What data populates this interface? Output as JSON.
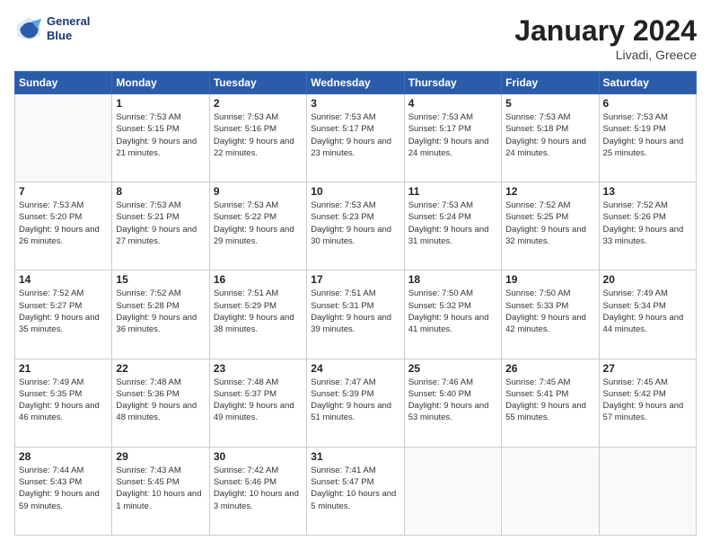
{
  "logo": {
    "line1": "General",
    "line2": "Blue"
  },
  "header": {
    "month": "January 2024",
    "location": "Livadi, Greece"
  },
  "weekdays": [
    "Sunday",
    "Monday",
    "Tuesday",
    "Wednesday",
    "Thursday",
    "Friday",
    "Saturday"
  ],
  "weeks": [
    [
      {
        "day": "",
        "sunrise": "",
        "sunset": "",
        "daylight": ""
      },
      {
        "day": "1",
        "sunrise": "Sunrise: 7:53 AM",
        "sunset": "Sunset: 5:15 PM",
        "daylight": "Daylight: 9 hours and 21 minutes."
      },
      {
        "day": "2",
        "sunrise": "Sunrise: 7:53 AM",
        "sunset": "Sunset: 5:16 PM",
        "daylight": "Daylight: 9 hours and 22 minutes."
      },
      {
        "day": "3",
        "sunrise": "Sunrise: 7:53 AM",
        "sunset": "Sunset: 5:17 PM",
        "daylight": "Daylight: 9 hours and 23 minutes."
      },
      {
        "day": "4",
        "sunrise": "Sunrise: 7:53 AM",
        "sunset": "Sunset: 5:17 PM",
        "daylight": "Daylight: 9 hours and 24 minutes."
      },
      {
        "day": "5",
        "sunrise": "Sunrise: 7:53 AM",
        "sunset": "Sunset: 5:18 PM",
        "daylight": "Daylight: 9 hours and 24 minutes."
      },
      {
        "day": "6",
        "sunrise": "Sunrise: 7:53 AM",
        "sunset": "Sunset: 5:19 PM",
        "daylight": "Daylight: 9 hours and 25 minutes."
      }
    ],
    [
      {
        "day": "7",
        "sunrise": "Sunrise: 7:53 AM",
        "sunset": "Sunset: 5:20 PM",
        "daylight": "Daylight: 9 hours and 26 minutes."
      },
      {
        "day": "8",
        "sunrise": "Sunrise: 7:53 AM",
        "sunset": "Sunset: 5:21 PM",
        "daylight": "Daylight: 9 hours and 27 minutes."
      },
      {
        "day": "9",
        "sunrise": "Sunrise: 7:53 AM",
        "sunset": "Sunset: 5:22 PM",
        "daylight": "Daylight: 9 hours and 29 minutes."
      },
      {
        "day": "10",
        "sunrise": "Sunrise: 7:53 AM",
        "sunset": "Sunset: 5:23 PM",
        "daylight": "Daylight: 9 hours and 30 minutes."
      },
      {
        "day": "11",
        "sunrise": "Sunrise: 7:53 AM",
        "sunset": "Sunset: 5:24 PM",
        "daylight": "Daylight: 9 hours and 31 minutes."
      },
      {
        "day": "12",
        "sunrise": "Sunrise: 7:52 AM",
        "sunset": "Sunset: 5:25 PM",
        "daylight": "Daylight: 9 hours and 32 minutes."
      },
      {
        "day": "13",
        "sunrise": "Sunrise: 7:52 AM",
        "sunset": "Sunset: 5:26 PM",
        "daylight": "Daylight: 9 hours and 33 minutes."
      }
    ],
    [
      {
        "day": "14",
        "sunrise": "Sunrise: 7:52 AM",
        "sunset": "Sunset: 5:27 PM",
        "daylight": "Daylight: 9 hours and 35 minutes."
      },
      {
        "day": "15",
        "sunrise": "Sunrise: 7:52 AM",
        "sunset": "Sunset: 5:28 PM",
        "daylight": "Daylight: 9 hours and 36 minutes."
      },
      {
        "day": "16",
        "sunrise": "Sunrise: 7:51 AM",
        "sunset": "Sunset: 5:29 PM",
        "daylight": "Daylight: 9 hours and 38 minutes."
      },
      {
        "day": "17",
        "sunrise": "Sunrise: 7:51 AM",
        "sunset": "Sunset: 5:31 PM",
        "daylight": "Daylight: 9 hours and 39 minutes."
      },
      {
        "day": "18",
        "sunrise": "Sunrise: 7:50 AM",
        "sunset": "Sunset: 5:32 PM",
        "daylight": "Daylight: 9 hours and 41 minutes."
      },
      {
        "day": "19",
        "sunrise": "Sunrise: 7:50 AM",
        "sunset": "Sunset: 5:33 PM",
        "daylight": "Daylight: 9 hours and 42 minutes."
      },
      {
        "day": "20",
        "sunrise": "Sunrise: 7:49 AM",
        "sunset": "Sunset: 5:34 PM",
        "daylight": "Daylight: 9 hours and 44 minutes."
      }
    ],
    [
      {
        "day": "21",
        "sunrise": "Sunrise: 7:49 AM",
        "sunset": "Sunset: 5:35 PM",
        "daylight": "Daylight: 9 hours and 46 minutes."
      },
      {
        "day": "22",
        "sunrise": "Sunrise: 7:48 AM",
        "sunset": "Sunset: 5:36 PM",
        "daylight": "Daylight: 9 hours and 48 minutes."
      },
      {
        "day": "23",
        "sunrise": "Sunrise: 7:48 AM",
        "sunset": "Sunset: 5:37 PM",
        "daylight": "Daylight: 9 hours and 49 minutes."
      },
      {
        "day": "24",
        "sunrise": "Sunrise: 7:47 AM",
        "sunset": "Sunset: 5:39 PM",
        "daylight": "Daylight: 9 hours and 51 minutes."
      },
      {
        "day": "25",
        "sunrise": "Sunrise: 7:46 AM",
        "sunset": "Sunset: 5:40 PM",
        "daylight": "Daylight: 9 hours and 53 minutes."
      },
      {
        "day": "26",
        "sunrise": "Sunrise: 7:45 AM",
        "sunset": "Sunset: 5:41 PM",
        "daylight": "Daylight: 9 hours and 55 minutes."
      },
      {
        "day": "27",
        "sunrise": "Sunrise: 7:45 AM",
        "sunset": "Sunset: 5:42 PM",
        "daylight": "Daylight: 9 hours and 57 minutes."
      }
    ],
    [
      {
        "day": "28",
        "sunrise": "Sunrise: 7:44 AM",
        "sunset": "Sunset: 5:43 PM",
        "daylight": "Daylight: 9 hours and 59 minutes."
      },
      {
        "day": "29",
        "sunrise": "Sunrise: 7:43 AM",
        "sunset": "Sunset: 5:45 PM",
        "daylight": "Daylight: 10 hours and 1 minute."
      },
      {
        "day": "30",
        "sunrise": "Sunrise: 7:42 AM",
        "sunset": "Sunset: 5:46 PM",
        "daylight": "Daylight: 10 hours and 3 minutes."
      },
      {
        "day": "31",
        "sunrise": "Sunrise: 7:41 AM",
        "sunset": "Sunset: 5:47 PM",
        "daylight": "Daylight: 10 hours and 5 minutes."
      },
      {
        "day": "",
        "sunrise": "",
        "sunset": "",
        "daylight": ""
      },
      {
        "day": "",
        "sunrise": "",
        "sunset": "",
        "daylight": ""
      },
      {
        "day": "",
        "sunrise": "",
        "sunset": "",
        "daylight": ""
      }
    ]
  ]
}
